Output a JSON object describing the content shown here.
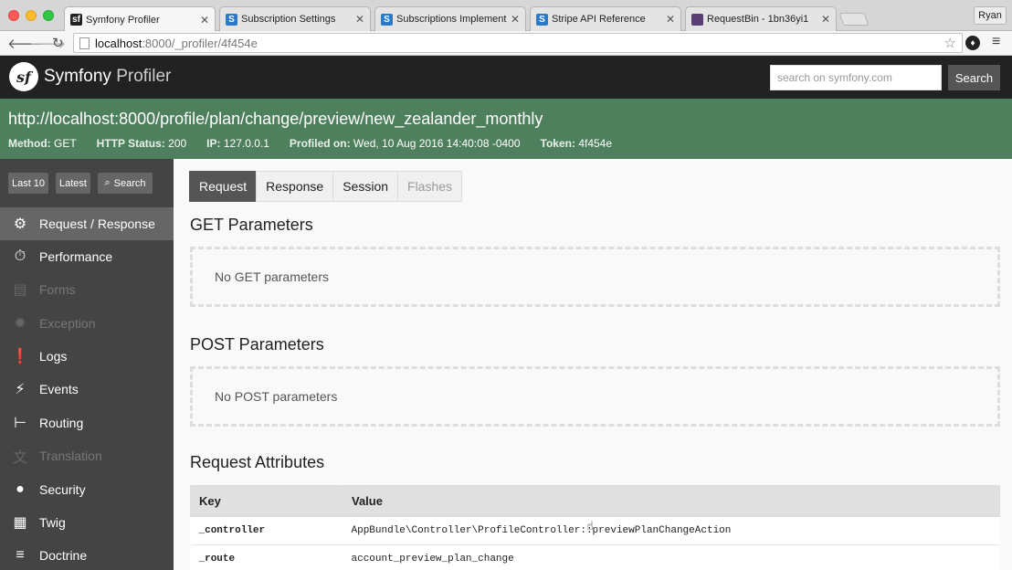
{
  "browser": {
    "tabs": [
      {
        "label": "Symfony Profiler",
        "favicon": "symfony-icon",
        "color": "#222222",
        "active": true
      },
      {
        "label": "Subscription Settings",
        "favicon": "stripe-icon",
        "color": "#2a7ac9"
      },
      {
        "label": "Subscriptions Implementati",
        "favicon": "stripe-icon",
        "color": "#2a7ac9"
      },
      {
        "label": "Stripe API Reference",
        "favicon": "stripe-icon",
        "color": "#2a7ac9"
      },
      {
        "label": "RequestBin - 1bn36yi1",
        "favicon": "requestbin-icon",
        "color": "#5a3f74"
      }
    ],
    "profile_name": "Ryan",
    "url_host": "localhost",
    "url_rest": ":8000/_profiler/4f454e"
  },
  "header": {
    "brand_bold": "Symfony",
    "brand_thin": " Profiler",
    "search_placeholder": "search on symfony.com",
    "search_button": "Search"
  },
  "summary": {
    "url": "http://localhost:8000/profile/plan/change/preview/new_zealander_monthly",
    "method_label": "Method:",
    "method": "GET",
    "status_label": "HTTP Status:",
    "status": "200",
    "ip_label": "IP:",
    "ip": "127.0.0.1",
    "profiled_label": "Profiled on:",
    "profiled": "Wed, 10 Aug 2016 14:40:08 -0400",
    "token_label": "Token:",
    "token": "4f454e"
  },
  "sidebar": {
    "buttons": {
      "last10": "Last 10",
      "latest": "Latest",
      "search": "Search"
    },
    "items": [
      {
        "label": "Request / Response",
        "icon": "gears-icon",
        "glyph": "⚙",
        "active": true
      },
      {
        "label": "Performance",
        "icon": "stopwatch-icon",
        "glyph": "⏱"
      },
      {
        "label": "Forms",
        "icon": "form-icon",
        "glyph": "▤",
        "disabled": true
      },
      {
        "label": "Exception",
        "icon": "bug-icon",
        "glyph": "✹",
        "disabled": true
      },
      {
        "label": "Logs",
        "icon": "logs-icon",
        "glyph": "❗"
      },
      {
        "label": "Events",
        "icon": "events-icon",
        "glyph": "⚡"
      },
      {
        "label": "Routing",
        "icon": "routing-icon",
        "glyph": "⊢"
      },
      {
        "label": "Translation",
        "icon": "translation-icon",
        "glyph": "文",
        "disabled": true
      },
      {
        "label": "Security",
        "icon": "user-icon",
        "glyph": "●"
      },
      {
        "label": "Twig",
        "icon": "twig-icon",
        "glyph": "▦"
      },
      {
        "label": "Doctrine",
        "icon": "database-icon",
        "glyph": "≡"
      }
    ]
  },
  "main": {
    "tabs": [
      {
        "label": "Request",
        "active": true
      },
      {
        "label": "Response"
      },
      {
        "label": "Session"
      },
      {
        "label": "Flashes",
        "disabled": true
      }
    ],
    "get_title": "GET Parameters",
    "get_empty": "No GET parameters",
    "post_title": "POST Parameters",
    "post_empty": "No POST parameters",
    "attr_title": "Request Attributes",
    "attr_headers": {
      "key": "Key",
      "value": "Value"
    },
    "attributes": [
      {
        "key": "_controller",
        "value": "AppBundle\\Controller\\ProfileController::previewPlanChangeAction"
      },
      {
        "key": "_route",
        "value": "account_preview_plan_change"
      }
    ]
  },
  "colors": {
    "summary_bg": "#4f805d",
    "header_bg": "#222222",
    "sidebar_bg": "#444444"
  }
}
